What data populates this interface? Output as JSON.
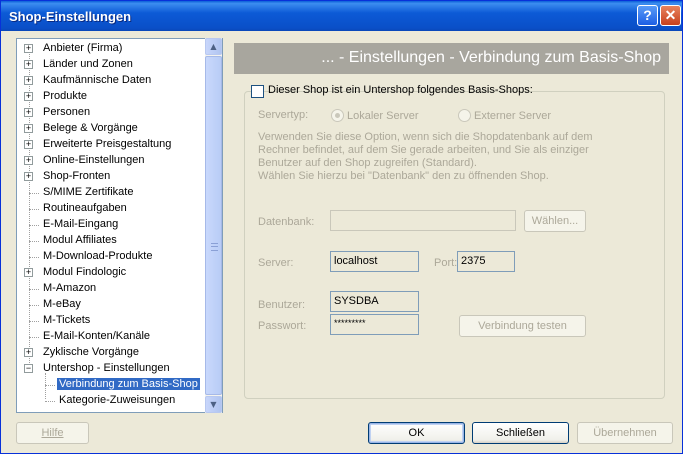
{
  "window": {
    "title": "Shop-Einstellungen",
    "help_btn": "?",
    "close_btn": "✕"
  },
  "tree": {
    "items": [
      {
        "label": "Anbieter (Firma)",
        "expander": "+"
      },
      {
        "label": "Länder und Zonen",
        "expander": "+"
      },
      {
        "label": "Kaufmännische Daten",
        "expander": "+"
      },
      {
        "label": "Produkte",
        "expander": "+"
      },
      {
        "label": "Personen",
        "expander": "+"
      },
      {
        "label": "Belege & Vorgänge",
        "expander": "+"
      },
      {
        "label": "Erweiterte Preisgestaltung",
        "expander": "+"
      },
      {
        "label": "Online-Einstellungen",
        "expander": "+"
      },
      {
        "label": "Shop-Fronten",
        "expander": "+"
      },
      {
        "label": "S/MIME Zertifikate",
        "expander": ""
      },
      {
        "label": "Routineaufgaben",
        "expander": ""
      },
      {
        "label": "E-Mail-Eingang",
        "expander": ""
      },
      {
        "label": "Modul Affiliates",
        "expander": ""
      },
      {
        "label": "M-Download-Produkte",
        "expander": ""
      },
      {
        "label": "Modul Findologic",
        "expander": "+"
      },
      {
        "label": "M-Amazon",
        "expander": ""
      },
      {
        "label": "M-eBay",
        "expander": ""
      },
      {
        "label": "M-Tickets",
        "expander": ""
      },
      {
        "label": "E-Mail-Konten/Kanäle",
        "expander": ""
      },
      {
        "label": "Zyklische Vorgänge",
        "expander": "+"
      },
      {
        "label": "Untershop - Einstellungen",
        "expander": "−"
      },
      {
        "label": "Verbindung zum Basis-Shop",
        "expander": "",
        "child": true,
        "selected": true
      },
      {
        "label": "Kategorie-Zuweisungen",
        "expander": "",
        "child": true
      }
    ]
  },
  "panel": {
    "header": "... - Einstellungen - Verbindung zum Basis-Shop",
    "checkbox_label": "Dieser Shop ist ein Untershop folgendes Basis-Shops:",
    "servertyp_label": "Servertyp:",
    "radio_local": "Lokaler Server",
    "radio_external": "Externer Server",
    "description": [
      "Verwenden Sie diese Option, wenn sich die Shopdatenbank auf dem",
      "Rechner befindet, auf dem Sie gerade arbeiten, und Sie als einziger",
      "Benutzer auf den Shop zugreifen (Standard).",
      "Wählen Sie hierzu bei \"Datenbank\" den zu öffnenden Shop."
    ],
    "datenbank_label": "Datenbank:",
    "datenbank_value": "",
    "waehlen_btn": "Wählen...",
    "server_label": "Server:",
    "server_value": "localhost",
    "port_label": "Port:",
    "port_value": "2375",
    "benutzer_label": "Benutzer:",
    "benutzer_value": "SYSDBA",
    "passwort_label": "Passwort:",
    "passwort_value": "*********",
    "test_btn": "Verbindung testen"
  },
  "footer": {
    "hilfe": "Hilfe",
    "ok": "OK",
    "schliessen": "Schließen",
    "uebernehmen": "Übernehmen"
  },
  "colors": {
    "titlebar": "#0a4fc8",
    "selection": "#316ac5",
    "header_bar": "#a8a69e"
  }
}
